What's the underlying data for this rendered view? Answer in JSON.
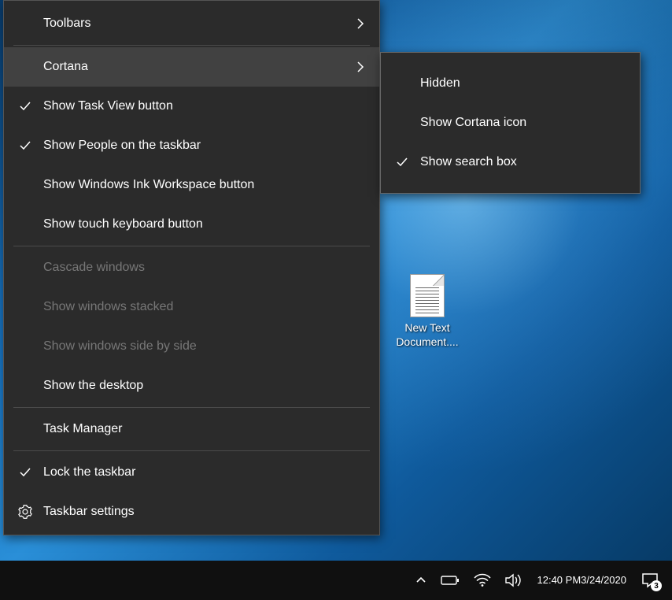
{
  "desktop": {
    "icons": [
      {
        "label": "New Text\nDocument...."
      }
    ]
  },
  "contextMenu": {
    "items": [
      {
        "label": "Toolbars",
        "hasSubmenu": true
      },
      {
        "label": "Cortana",
        "hasSubmenu": true
      },
      {
        "label": "Show Task View button",
        "checked": true
      },
      {
        "label": "Show People on the taskbar",
        "checked": true
      },
      {
        "label": "Show Windows Ink Workspace button"
      },
      {
        "label": "Show touch keyboard button"
      },
      {
        "label": "Cascade windows",
        "disabled": true
      },
      {
        "label": "Show windows stacked",
        "disabled": true
      },
      {
        "label": "Show windows side by side",
        "disabled": true
      },
      {
        "label": "Show the desktop"
      },
      {
        "label": "Task Manager"
      },
      {
        "label": "Lock the taskbar",
        "checked": true
      },
      {
        "label": "Taskbar settings",
        "icon": "gear"
      }
    ]
  },
  "submenu": {
    "items": [
      {
        "label": "Hidden"
      },
      {
        "label": "Show Cortana icon"
      },
      {
        "label": "Show search box",
        "checked": true
      }
    ]
  },
  "taskbar": {
    "time": "12:40 PM",
    "date": "3/24/2020",
    "notificationCount": "3"
  }
}
